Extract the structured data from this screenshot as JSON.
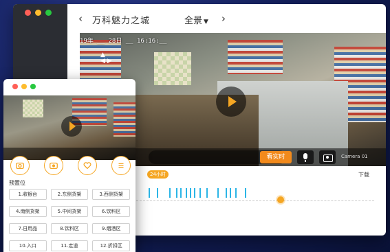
{
  "header": {
    "title": "万科魅力之城",
    "view_mode": "全景",
    "back_glyph": "‹",
    "forward_glyph": "›"
  },
  "video": {
    "osd_timestamp": "19年 __ 28日 __ 16:16:__",
    "live_button": "看实时",
    "camera_label": "Camera 01",
    "camera_number": "01"
  },
  "timeline": {
    "date_badge": "24小时",
    "next_label": "下载"
  },
  "mini": {
    "tools": [
      {
        "name": "camera-icon"
      },
      {
        "name": "record-icon"
      },
      {
        "name": "heart-icon"
      },
      {
        "name": "list-icon"
      }
    ],
    "preset_title": "预置位",
    "presets": [
      "1.收银台",
      "2.东侧货架",
      "3.西侧货架",
      "4.南侧货架",
      "5.中间货架",
      "6.饮料区",
      "7.日用品",
      "8.饮料区",
      "9.烟酒区",
      "10.入口",
      "11.走道",
      "12.折扣区"
    ]
  },
  "colors": {
    "accent": "#f5a623",
    "timeline_tick": "#2bb5e6",
    "sidebar": "#2b2d33"
  }
}
